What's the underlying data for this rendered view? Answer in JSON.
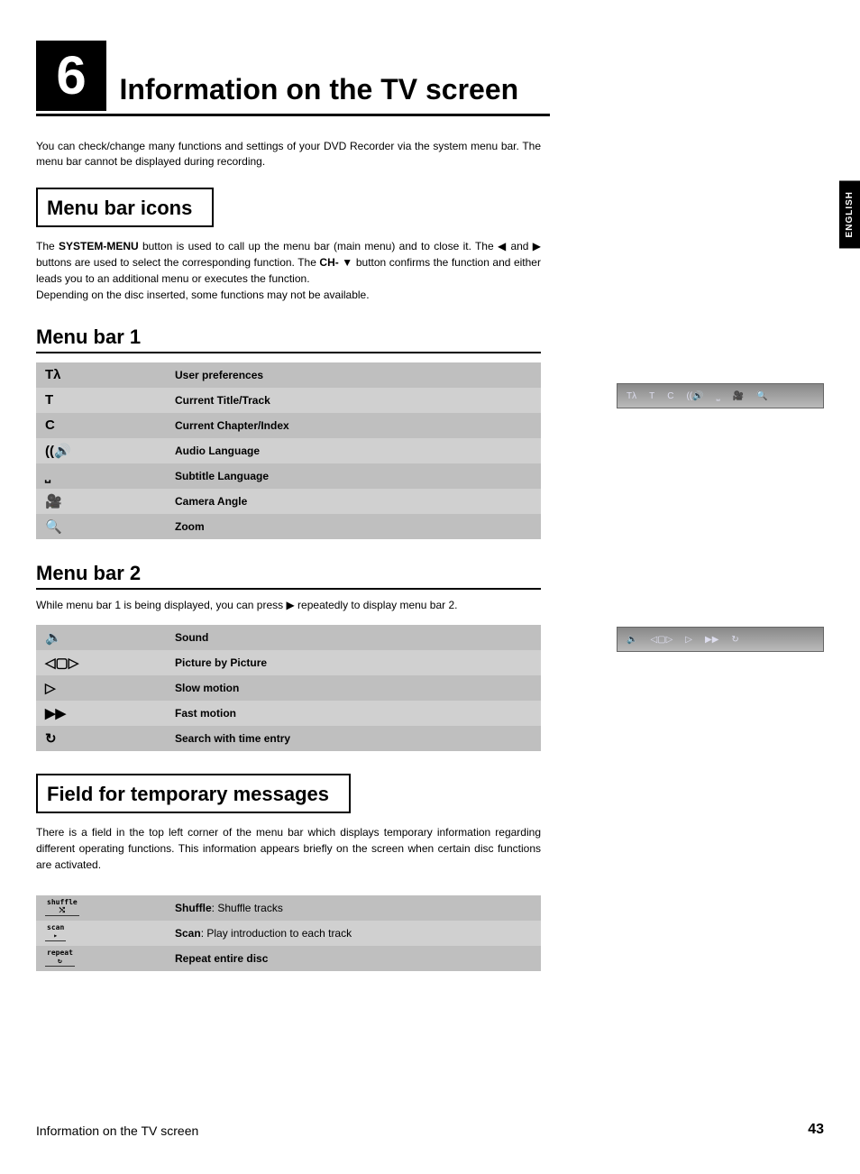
{
  "chapter_number": "6",
  "page_title": "Information on the TV screen",
  "side_tab": "ENGLISH",
  "intro": "You can check/change many functions and settings of your DVD Recorder via the system menu bar. The menu bar cannot be displayed during recording.",
  "section_menu_bar_icons": {
    "heading": "Menu bar icons",
    "text_parts": {
      "p1": "The ",
      "btn1": "SYSTEM-MENU",
      "p2": " button is used to call up the menu bar (main menu) and to close it. The ",
      "sym_left": "◀",
      "p3": " and ",
      "sym_right": "▶",
      "p4": " buttons are used to select the corresponding function. The ",
      "btn2": "CH-",
      "sym_down": "▼",
      "p5": " button confirms the function and either leads you to an additional menu or executes the function.",
      "p6": "Depending on the disc inserted, some functions may not be available."
    }
  },
  "menubar1": {
    "heading": "Menu bar 1",
    "rows": [
      {
        "icon": "user-prefs-icon",
        "glyph": "Tλ",
        "label": "User preferences"
      },
      {
        "icon": "title-track-icon",
        "glyph": "T",
        "label": "Current Title/Track"
      },
      {
        "icon": "chapter-index-icon",
        "glyph": "C",
        "label": "Current Chapter/Index"
      },
      {
        "icon": "audio-lang-icon",
        "glyph": "((🔊",
        "label": "Audio Language"
      },
      {
        "icon": "subtitle-lang-icon",
        "glyph": "⎵",
        "label": "Subtitle Language"
      },
      {
        "icon": "camera-angle-icon",
        "glyph": "🎥",
        "label": "Camera Angle"
      },
      {
        "icon": "zoom-icon",
        "glyph": "🔍",
        "label": "Zoom"
      }
    ]
  },
  "menubar2": {
    "heading": "Menu bar 2",
    "intro_parts": {
      "p1": "While menu bar 1 is being displayed, you can press ",
      "sym": "▶",
      "p2": " repeatedly to display menu bar 2."
    },
    "rows": [
      {
        "icon": "sound-icon",
        "glyph": "🔈",
        "label": "Sound"
      },
      {
        "icon": "picture-by-picture-icon",
        "glyph": "◁▢▷",
        "label": "Picture by Picture"
      },
      {
        "icon": "slow-motion-icon",
        "glyph": "▷",
        "label": "Slow motion"
      },
      {
        "icon": "fast-motion-icon",
        "glyph": "▶▶",
        "label": "Fast motion"
      },
      {
        "icon": "time-search-icon",
        "glyph": "↻",
        "label": "Search with time entry"
      }
    ]
  },
  "temp_messages": {
    "heading": "Field for temporary messages",
    "text": "There is a field in the top left corner of the menu bar which displays temporary information regarding different operating functions. This information appears briefly on the screen when certain disc functions are activated.",
    "rows": [
      {
        "icon": "shuffle-icon",
        "glyph_top": "shuffle",
        "glyph_sub": "⤭",
        "label_bold": "Shuffle",
        "label_rest": ": Shuffle tracks"
      },
      {
        "icon": "scan-icon",
        "glyph_top": "scan",
        "glyph_sub": "▸",
        "label_bold": "Scan",
        "label_rest": ": Play introduction to each track"
      },
      {
        "icon": "repeat-icon",
        "glyph_top": "repeat",
        "glyph_sub": "↻",
        "label_bold": "Repeat entire disc",
        "label_rest": ""
      }
    ]
  },
  "footer": {
    "text": "Information on the TV screen",
    "page": "43"
  }
}
